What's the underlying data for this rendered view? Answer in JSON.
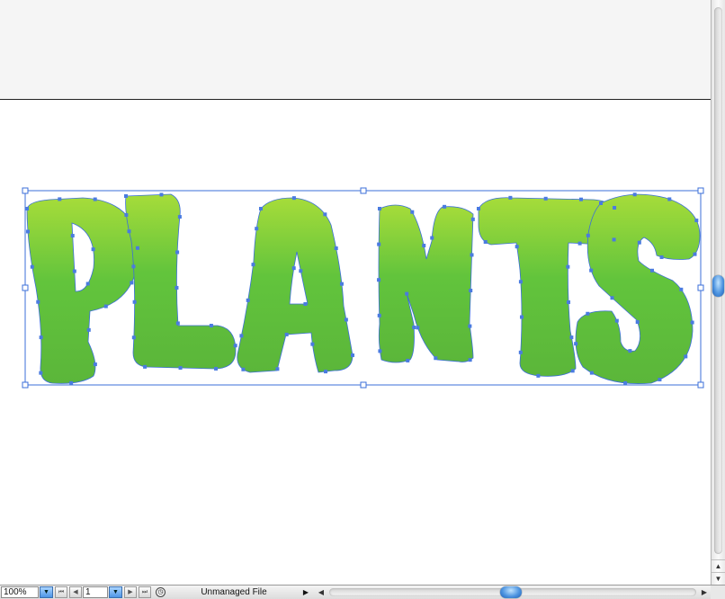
{
  "artwork": {
    "word": "PLANTS",
    "gradient_top": "#a6dc3a",
    "gradient_bottom": "#5bb63a",
    "outline_color": "#3b6fd8",
    "anchor_color": "#4a7be0"
  },
  "statusbar": {
    "zoom_value": "100%",
    "page_value": "1",
    "status_text": "Unmanaged File",
    "zoom_dropdown_icon": "triangle-down",
    "first_page_icon": "first-page",
    "prev_page_icon": "previous-page",
    "page_dropdown_icon": "triangle-down",
    "next_page_icon": "next-page",
    "last_page_icon": "last-page",
    "status_menu_icon": "triangle-right"
  },
  "scrollbars": {
    "up_arrow": "▲",
    "down_arrow": "▼",
    "left_arrow": "◀",
    "right_arrow": "▶"
  }
}
